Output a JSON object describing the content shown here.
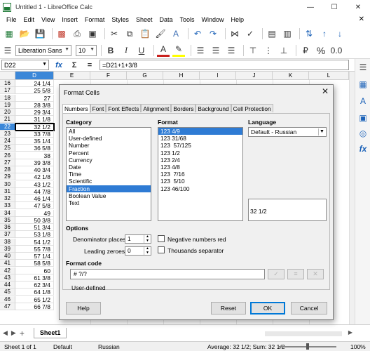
{
  "window": {
    "title": "Untitled 1 - LibreOffice Calc"
  },
  "menu": [
    "File",
    "Edit",
    "View",
    "Insert",
    "Format",
    "Styles",
    "Sheet",
    "Data",
    "Tools",
    "Window",
    "Help"
  ],
  "toolbar": {
    "font_name": "Liberation Sans",
    "font_size": "10"
  },
  "formula_bar": {
    "name_box": "D22",
    "formula": "=D21+1+3/8"
  },
  "grid": {
    "columns": [
      "D",
      "E",
      "F",
      "G",
      "H",
      "I",
      "J",
      "K",
      "L"
    ],
    "rows": [
      {
        "n": "16",
        "d": "24 1/4"
      },
      {
        "n": "17",
        "d": "25 5/8"
      },
      {
        "n": "18",
        "d": "27"
      },
      {
        "n": "19",
        "d": "28 3/8"
      },
      {
        "n": "20",
        "d": "29 3/4"
      },
      {
        "n": "21",
        "d": "31 1/8"
      },
      {
        "n": "22",
        "d": "32 1/2"
      },
      {
        "n": "23",
        "d": "33 7/8"
      },
      {
        "n": "24",
        "d": "35 1/4"
      },
      {
        "n": "25",
        "d": "36 5/8"
      },
      {
        "n": "26",
        "d": "38"
      },
      {
        "n": "27",
        "d": "39 3/8"
      },
      {
        "n": "28",
        "d": "40 3/4"
      },
      {
        "n": "29",
        "d": "42 1/8"
      },
      {
        "n": "30",
        "d": "43 1/2"
      },
      {
        "n": "31",
        "d": "44 7/8"
      },
      {
        "n": "32",
        "d": "46 1/4"
      },
      {
        "n": "33",
        "d": "47 5/8"
      },
      {
        "n": "34",
        "d": "49"
      },
      {
        "n": "35",
        "d": "50 3/8"
      },
      {
        "n": "36",
        "d": "51 3/4"
      },
      {
        "n": "37",
        "d": "53 1/8"
      },
      {
        "n": "38",
        "d": "54 1/2"
      },
      {
        "n": "39",
        "d": "55 7/8"
      },
      {
        "n": "40",
        "d": "57 1/4"
      },
      {
        "n": "41",
        "d": "58 5/8"
      },
      {
        "n": "42",
        "d": "60"
      },
      {
        "n": "43",
        "d": "61 3/8"
      },
      {
        "n": "44",
        "d": "62 3/4"
      },
      {
        "n": "45",
        "d": "64 1/8"
      },
      {
        "n": "46",
        "d": "65 1/2"
      },
      {
        "n": "47",
        "d": "66 7/8"
      }
    ],
    "selected_row": "22"
  },
  "sheet_tabs": [
    "Sheet1"
  ],
  "status": {
    "sheet": "Sheet 1 of 1",
    "style": "Default",
    "language": "Russian",
    "summary": "Average: 32 1/2; Sum: 32 1/2",
    "zoom": "100%"
  },
  "dialog": {
    "title": "Format Cells",
    "tabs": [
      "Numbers",
      "Font",
      "Font Effects",
      "Alignment",
      "Borders",
      "Background",
      "Cell Protection"
    ],
    "category_label": "Category",
    "categories": [
      "All",
      "User-defined",
      "Number",
      "Percent",
      "Currency",
      "Date",
      "Time",
      "Scientific",
      "Fraction",
      "Boolean Value",
      "Text"
    ],
    "selected_category": "Fraction",
    "format_label": "Format",
    "formats": [
      "123 4/9",
      "123 31/68",
      "123  57/125",
      "123 1/2",
      "123 2/4",
      "123 4/8",
      "123  7/16",
      "123  5/10",
      "123 46/100"
    ],
    "selected_format": "123 4/9",
    "language_label": "Language",
    "language_value": "Default - Russian",
    "preview": "32 1/2",
    "options_label": "Options",
    "denominator_label": "Denominator places:",
    "denominator_value": "1",
    "leading_zeroes_label": "Leading zeroes:",
    "leading_zeroes_value": "0",
    "negative_red_label": "Negative numbers red",
    "thousands_label": "Thousands separator",
    "format_code_label": "Format code",
    "format_code_value": "# ?/?",
    "format_code_desc": "User-defined",
    "buttons": {
      "help": "Help",
      "reset": "Reset",
      "ok": "OK",
      "cancel": "Cancel"
    }
  }
}
